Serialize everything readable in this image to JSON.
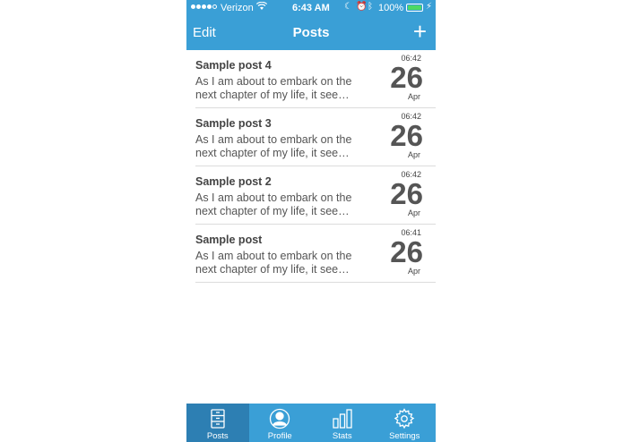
{
  "status_bar": {
    "carrier": "Verizon",
    "time": "6:43 AM",
    "battery_percent": "100%"
  },
  "nav": {
    "edit_label": "Edit",
    "title": "Posts",
    "add_label": "+"
  },
  "posts": [
    {
      "title": "Sample post 4",
      "excerpt": "As I am about to embark on the next chapter of my life, it see…",
      "time": "06:42",
      "day": "26",
      "month": "Apr"
    },
    {
      "title": "Sample post 3",
      "excerpt": "As I am about to embark on the next chapter of my life, it see…",
      "time": "06:42",
      "day": "26",
      "month": "Apr"
    },
    {
      "title": "Sample post 2",
      "excerpt": "As I am about to embark on the next chapter of my life, it see…",
      "time": "06:42",
      "day": "26",
      "month": "Apr"
    },
    {
      "title": "Sample post",
      "excerpt": "As I am about to embark on the next chapter of my life, it see…",
      "time": "06:41",
      "day": "26",
      "month": "Apr"
    }
  ],
  "tabs": [
    {
      "label": "Posts",
      "icon": "drawer-icon",
      "active": true
    },
    {
      "label": "Profile",
      "icon": "person-icon",
      "active": false
    },
    {
      "label": "Stats",
      "icon": "bar-chart-icon",
      "active": false
    },
    {
      "label": "Settings",
      "icon": "gear-icon",
      "active": false
    }
  ],
  "colors": {
    "accent": "#3a9fd6",
    "active_tab": "#2d7fb3",
    "battery": "#4cd964"
  }
}
